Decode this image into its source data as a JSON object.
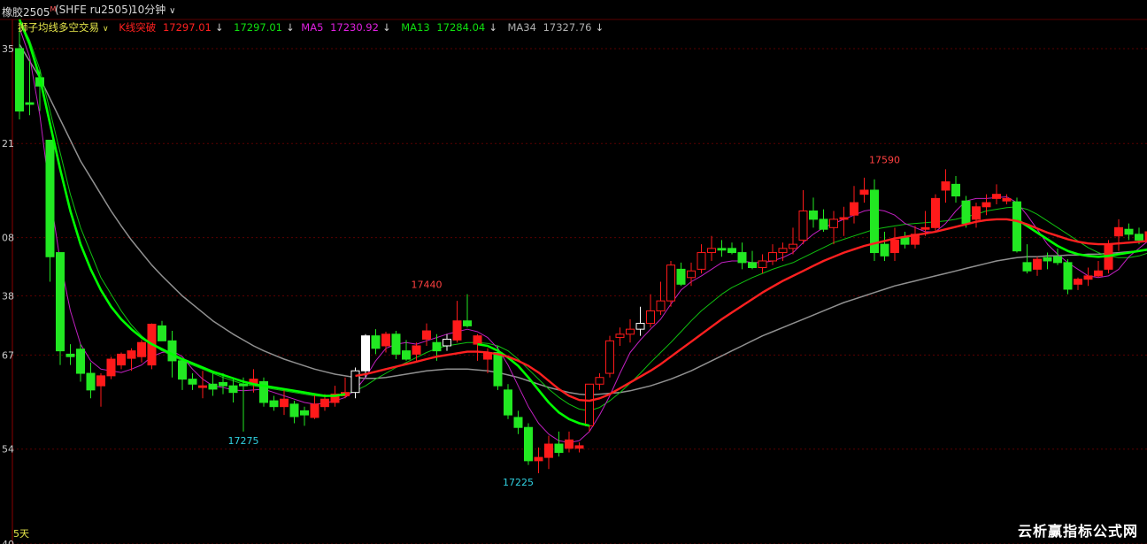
{
  "window": {
    "title": "橡胶2505",
    "title_sup": "M",
    "symbol": "(SHFE ru2505)",
    "period": "10分钟",
    "period_arrow": "∨"
  },
  "indicator": {
    "name": "狮子均线多空交易",
    "name_arrow": "∨",
    "k_label": "K线突破",
    "k_value": "17297.01",
    "k_close": "17297.01",
    "ma5_label": "MA5",
    "ma5_value": "17230.92",
    "ma13_label": "MA13",
    "ma13_value": "17284.04",
    "ma34_label": "MA34",
    "ma34_value": "17327.76",
    "down_arrow": "↓"
  },
  "colors": {
    "background": "#000000",
    "grid": "#5a0000",
    "up": "#ff1a1a",
    "down": "#22e822",
    "neutral": "#ffffff",
    "ma5": "#c020c0",
    "ma13": "#10c010",
    "ma34": "#909090",
    "k_line": "#ff2020",
    "bold_green": "#00ff00",
    "label_cyan": "#30d0e0",
    "label_red": "#ff4040",
    "title_yellow": "#e6e64a"
  },
  "footer": {
    "days_label": "5天",
    "watermark": "云析赢指标公式网"
  },
  "chart_data": {
    "type": "candlestick",
    "y_tick_labels": [
      {
        "value": 17735,
        "label": "35"
      },
      {
        "value": 17621,
        "label": "21"
      },
      {
        "value": 17508,
        "label": "08"
      },
      {
        "value": 17438,
        "label": "38"
      },
      {
        "value": 17367,
        "label": "67"
      },
      {
        "value": 17254,
        "label": "54"
      },
      {
        "value": 17140,
        "label": "40"
      }
    ],
    "ylim": [
      17140,
      17770
    ],
    "annotations": [
      {
        "label": "17275",
        "index": 22,
        "value": 17275,
        "kind": "low"
      },
      {
        "label": "17440",
        "index": 40,
        "value": 17440,
        "kind": "high"
      },
      {
        "label": "17225",
        "index": 49,
        "value": 17225,
        "kind": "low"
      },
      {
        "label": "17590",
        "index": 85,
        "value": 17590,
        "kind": "high"
      }
    ],
    "candles": [
      [
        17735,
        17760,
        17650,
        17660
      ],
      [
        17670,
        17720,
        17655,
        17668
      ],
      [
        17700,
        17710,
        17660,
        17690
      ],
      [
        17625,
        17625,
        17455,
        17485
      ],
      [
        17490,
        17490,
        17355,
        17372
      ],
      [
        17368,
        17380,
        17355,
        17365
      ],
      [
        17374,
        17380,
        17335,
        17345
      ],
      [
        17345,
        17358,
        17315,
        17325
      ],
      [
        17330,
        17345,
        17305,
        17342
      ],
      [
        17342,
        17365,
        17338,
        17362
      ],
      [
        17355,
        17370,
        17350,
        17368
      ],
      [
        17363,
        17375,
        17348,
        17372
      ],
      [
        17365,
        17385,
        17358,
        17382
      ],
      [
        17355,
        17405,
        17350,
        17404
      ],
      [
        17402,
        17408,
        17385,
        17384
      ],
      [
        17384,
        17396,
        17340,
        17360
      ],
      [
        17360,
        17362,
        17325,
        17338
      ],
      [
        17338,
        17345,
        17325,
        17332
      ],
      [
        17328,
        17348,
        17315,
        17330
      ],
      [
        17332,
        17345,
        17318,
        17326
      ],
      [
        17334,
        17345,
        17320,
        17330
      ],
      [
        17330,
        17340,
        17310,
        17322
      ],
      [
        17332,
        17340,
        17275,
        17330
      ],
      [
        17332,
        17350,
        17322,
        17338
      ],
      [
        17335,
        17340,
        17305,
        17310
      ],
      [
        17312,
        17318,
        17300,
        17305
      ],
      [
        17305,
        17325,
        17295,
        17314
      ],
      [
        17308,
        17312,
        17285,
        17293
      ],
      [
        17300,
        17305,
        17282,
        17295
      ],
      [
        17292,
        17320,
        17290,
        17308
      ],
      [
        17305,
        17320,
        17300,
        17314
      ],
      [
        17310,
        17330,
        17305,
        17320
      ],
      [
        17318,
        17340,
        17315,
        17322
      ],
      [
        17322,
        17352,
        17315,
        17348
      ],
      [
        17348,
        17392,
        17340,
        17390
      ],
      [
        17390,
        17398,
        17368,
        17375
      ],
      [
        17378,
        17395,
        17370,
        17392
      ],
      [
        17392,
        17396,
        17362,
        17368
      ],
      [
        17372,
        17385,
        17360,
        17362
      ],
      [
        17368,
        17382,
        17360,
        17378
      ],
      [
        17386,
        17405,
        17378,
        17396
      ],
      [
        17382,
        17392,
        17360,
        17372
      ],
      [
        17378,
        17392,
        17372,
        17386
      ],
      [
        17385,
        17432,
        17382,
        17408
      ],
      [
        17408,
        17440,
        17400,
        17402
      ],
      [
        17380,
        17392,
        17360,
        17390
      ],
      [
        17362,
        17375,
        17345,
        17370
      ],
      [
        17370,
        17378,
        17325,
        17330
      ],
      [
        17325,
        17332,
        17290,
        17295
      ],
      [
        17292,
        17300,
        17272,
        17280
      ],
      [
        17280,
        17285,
        17235,
        17240
      ],
      [
        17240,
        17256,
        17225,
        17244
      ],
      [
        17244,
        17270,
        17230,
        17260
      ],
      [
        17260,
        17275,
        17245,
        17250
      ],
      [
        17255,
        17275,
        17250,
        17265
      ],
      [
        17255,
        17262,
        17250,
        17258
      ],
      [
        17282,
        17330,
        17275,
        17332
      ],
      [
        17332,
        17345,
        17325,
        17340
      ],
      [
        17345,
        17390,
        17340,
        17384
      ],
      [
        17388,
        17400,
        17378,
        17392
      ],
      [
        17392,
        17410,
        17382,
        17398
      ],
      [
        17398,
        17425,
        17390,
        17405
      ],
      [
        17405,
        17440,
        17400,
        17420
      ],
      [
        17420,
        17455,
        17415,
        17432
      ],
      [
        17432,
        17480,
        17425,
        17475
      ],
      [
        17470,
        17478,
        17450,
        17452
      ],
      [
        17460,
        17478,
        17450,
        17468
      ],
      [
        17470,
        17500,
        17465,
        17490
      ],
      [
        17490,
        17510,
        17480,
        17495
      ],
      [
        17495,
        17505,
        17485,
        17493
      ],
      [
        17495,
        17502,
        17488,
        17490
      ],
      [
        17490,
        17502,
        17470,
        17478
      ],
      [
        17478,
        17492,
        17470,
        17472
      ],
      [
        17472,
        17488,
        17465,
        17480
      ],
      [
        17480,
        17500,
        17475,
        17490
      ],
      [
        17490,
        17502,
        17480,
        17495
      ],
      [
        17495,
        17520,
        17488,
        17500
      ],
      [
        17505,
        17565,
        17500,
        17540
      ],
      [
        17540,
        17556,
        17520,
        17530
      ],
      [
        17530,
        17542,
        17515,
        17518
      ],
      [
        17520,
        17540,
        17500,
        17530
      ],
      [
        17530,
        17545,
        17510,
        17532
      ],
      [
        17535,
        17570,
        17525,
        17550
      ],
      [
        17560,
        17580,
        17550,
        17565
      ],
      [
        17565,
        17578,
        17480,
        17490
      ],
      [
        17500,
        17515,
        17480,
        17486
      ],
      [
        17490,
        17520,
        17480,
        17505
      ],
      [
        17508,
        17515,
        17495,
        17500
      ],
      [
        17500,
        17522,
        17495,
        17512
      ],
      [
        17518,
        17540,
        17510,
        17520
      ],
      [
        17520,
        17560,
        17515,
        17555
      ],
      [
        17565,
        17590,
        17550,
        17575
      ],
      [
        17572,
        17582,
        17550,
        17558
      ],
      [
        17552,
        17558,
        17520,
        17525
      ],
      [
        17530,
        17550,
        17520,
        17545
      ],
      [
        17545,
        17560,
        17535,
        17550
      ],
      [
        17555,
        17572,
        17548,
        17560
      ],
      [
        17552,
        17560,
        17548,
        17555
      ],
      [
        17551,
        17556,
        17490,
        17492
      ],
      [
        17478,
        17500,
        17465,
        17468
      ],
      [
        17470,
        17485,
        17462,
        17482
      ],
      [
        17484,
        17490,
        17470,
        17480
      ],
      [
        17485,
        17495,
        17475,
        17478
      ],
      [
        17478,
        17482,
        17440,
        17446
      ],
      [
        17452,
        17460,
        17445,
        17458
      ],
      [
        17458,
        17472,
        17450,
        17462
      ],
      [
        17462,
        17480,
        17460,
        17468
      ],
      [
        17470,
        17505,
        17465,
        17500
      ],
      [
        17510,
        17530,
        17492,
        17520
      ],
      [
        17518,
        17525,
        17505,
        17512
      ],
      [
        17512,
        17520,
        17500,
        17505
      ],
      [
        17505,
        17520,
        17498,
        17515
      ],
      [
        17510,
        17545,
        17505,
        17528
      ]
    ],
    "neutral_indices": [
      33,
      34,
      42,
      61
    ],
    "ma5": [
      17760,
      17725,
      17655,
      17560,
      17480,
      17420,
      17380,
      17360,
      17350,
      17348,
      17346,
      17350,
      17355,
      17365,
      17370,
      17372,
      17365,
      17350,
      17338,
      17330,
      17328,
      17325,
      17324,
      17325,
      17326,
      17322,
      17318,
      17314,
      17310,
      17308,
      17309,
      17312,
      17316,
      17325,
      17340,
      17360,
      17375,
      17380,
      17382,
      17380,
      17384,
      17388,
      17392,
      17395,
      17398,
      17395,
      17388,
      17375,
      17355,
      17330,
      17305,
      17285,
      17272,
      17264,
      17262,
      17264,
      17275,
      17295,
      17318,
      17345,
      17370,
      17385,
      17398,
      17410,
      17428,
      17445,
      17455,
      17462,
      17470,
      17478,
      17480,
      17480,
      17478,
      17478,
      17480,
      17484,
      17490,
      17502,
      17512,
      17520,
      17525,
      17530,
      17535,
      17540,
      17542,
      17540,
      17535,
      17525,
      17520,
      17515,
      17515,
      17525,
      17540,
      17552,
      17555,
      17555,
      17556,
      17557,
      17550,
      17535,
      17518,
      17500,
      17488,
      17478,
      17470,
      17462,
      17460,
      17462,
      17470,
      17485,
      17495,
      17505,
      17510,
      17515
    ],
    "ma13": [
      17770,
      17745,
      17710,
      17660,
      17610,
      17560,
      17520,
      17490,
      17460,
      17440,
      17420,
      17403,
      17390,
      17380,
      17372,
      17366,
      17360,
      17355,
      17350,
      17345,
      17340,
      17336,
      17332,
      17330,
      17328,
      17326,
      17324,
      17322,
      17320,
      17318,
      17317,
      17318,
      17320,
      17324,
      17330,
      17338,
      17345,
      17352,
      17358,
      17364,
      17370,
      17375,
      17378,
      17380,
      17382,
      17382,
      17381,
      17378,
      17372,
      17362,
      17350,
      17338,
      17326,
      17316,
      17308,
      17302,
      17300,
      17304,
      17312,
      17322,
      17333,
      17345,
      17358,
      17370,
      17382,
      17395,
      17408,
      17420,
      17430,
      17440,
      17448,
      17454,
      17460,
      17465,
      17470,
      17474,
      17478,
      17484,
      17490,
      17496,
      17502,
      17506,
      17510,
      17514,
      17518,
      17520,
      17522,
      17524,
      17525,
      17526,
      17527,
      17528,
      17530,
      17533,
      17536,
      17540,
      17542,
      17544,
      17545,
      17542,
      17536,
      17528,
      17520,
      17512,
      17504,
      17496,
      17490,
      17486,
      17484,
      17484,
      17486,
      17490,
      17494,
      17498
    ],
    "ma34": [
      17740,
      17720,
      17700,
      17675,
      17650,
      17625,
      17600,
      17580,
      17560,
      17540,
      17522,
      17505,
      17490,
      17475,
      17462,
      17450,
      17438,
      17428,
      17418,
      17408,
      17400,
      17392,
      17385,
      17378,
      17372,
      17367,
      17362,
      17358,
      17354,
      17350,
      17347,
      17344,
      17342,
      17340,
      17339,
      17339,
      17340,
      17342,
      17344,
      17346,
      17348,
      17349,
      17350,
      17350,
      17350,
      17349,
      17348,
      17346,
      17343,
      17340,
      17336,
      17332,
      17328,
      17325,
      17322,
      17320,
      17319,
      17320,
      17321,
      17322,
      17324,
      17327,
      17330,
      17334,
      17338,
      17343,
      17348,
      17354,
      17360,
      17366,
      17372,
      17378,
      17384,
      17390,
      17395,
      17400,
      17405,
      17410,
      17415,
      17420,
      17425,
      17430,
      17434,
      17438,
      17442,
      17446,
      17450,
      17453,
      17456,
      17459,
      17462,
      17465,
      17468,
      17471,
      17474,
      17477,
      17480,
      17482,
      17484,
      17485,
      17485,
      17486,
      17486,
      17487,
      17487,
      17488,
      17488,
      17489,
      17490,
      17491,
      17492,
      17493,
      17494,
      17495
    ],
    "k_line": [
      null,
      null,
      null,
      null,
      null,
      null,
      null,
      null,
      null,
      null,
      null,
      null,
      null,
      null,
      null,
      null,
      null,
      null,
      null,
      null,
      null,
      null,
      null,
      null,
      null,
      null,
      null,
      null,
      null,
      null,
      null,
      null,
      null,
      17342,
      17344,
      17347,
      17350,
      17353,
      17356,
      17359,
      17362,
      17365,
      17367,
      17369,
      17371,
      17371,
      17370,
      17368,
      17365,
      17360,
      17354,
      17346,
      17336,
      17326,
      17318,
      17313,
      17312,
      17315,
      17320,
      17327,
      17334,
      17341,
      17348,
      17356,
      17365,
      17374,
      17383,
      17392,
      17401,
      17410,
      17418,
      17426,
      17434,
      17442,
      17449,
      17456,
      17462,
      17468,
      17474,
      17480,
      17485,
      17490,
      17494,
      17498,
      17501,
      17504,
      17507,
      17509,
      17511,
      17513,
      17515,
      17518,
      17521,
      17524,
      17527,
      17529,
      17530,
      17530,
      17528,
      17524,
      17519,
      17514,
      17510,
      17506,
      17503,
      17501,
      17500,
      17500,
      17501,
      17502,
      17503,
      17504,
      17505,
      17506
    ],
    "bold_green_line": [
      17770,
      17740,
      17700,
      17645,
      17590,
      17540,
      17500,
      17470,
      17445,
      17425,
      17410,
      17398,
      17388,
      17380,
      17374,
      17368,
      17362,
      17357,
      17352,
      17347,
      17343,
      17339,
      17335,
      17332,
      17330,
      17328,
      17326,
      17324,
      17322,
      17320,
      17318,
      17318,
      17320,
      null,
      null,
      null,
      null,
      null,
      null,
      null,
      null,
      null,
      null,
      null,
      null,
      17380,
      17378,
      17372,
      17364,
      17354,
      17340,
      17325,
      17310,
      17298,
      17290,
      17285,
      17282,
      null,
      null,
      null,
      null,
      null,
      null,
      null,
      null,
      null,
      null,
      null,
      null,
      null,
      null,
      null,
      null,
      null,
      null,
      null,
      null,
      null,
      null,
      null,
      null,
      null,
      null,
      null,
      null,
      null,
      null,
      null,
      null,
      null,
      null,
      null,
      null,
      null,
      null,
      null,
      null,
      null,
      17530,
      17522,
      17514,
      17506,
      17498,
      17492,
      17488,
      17486,
      17485,
      17486,
      17488,
      17490,
      17492,
      17494
    ]
  }
}
